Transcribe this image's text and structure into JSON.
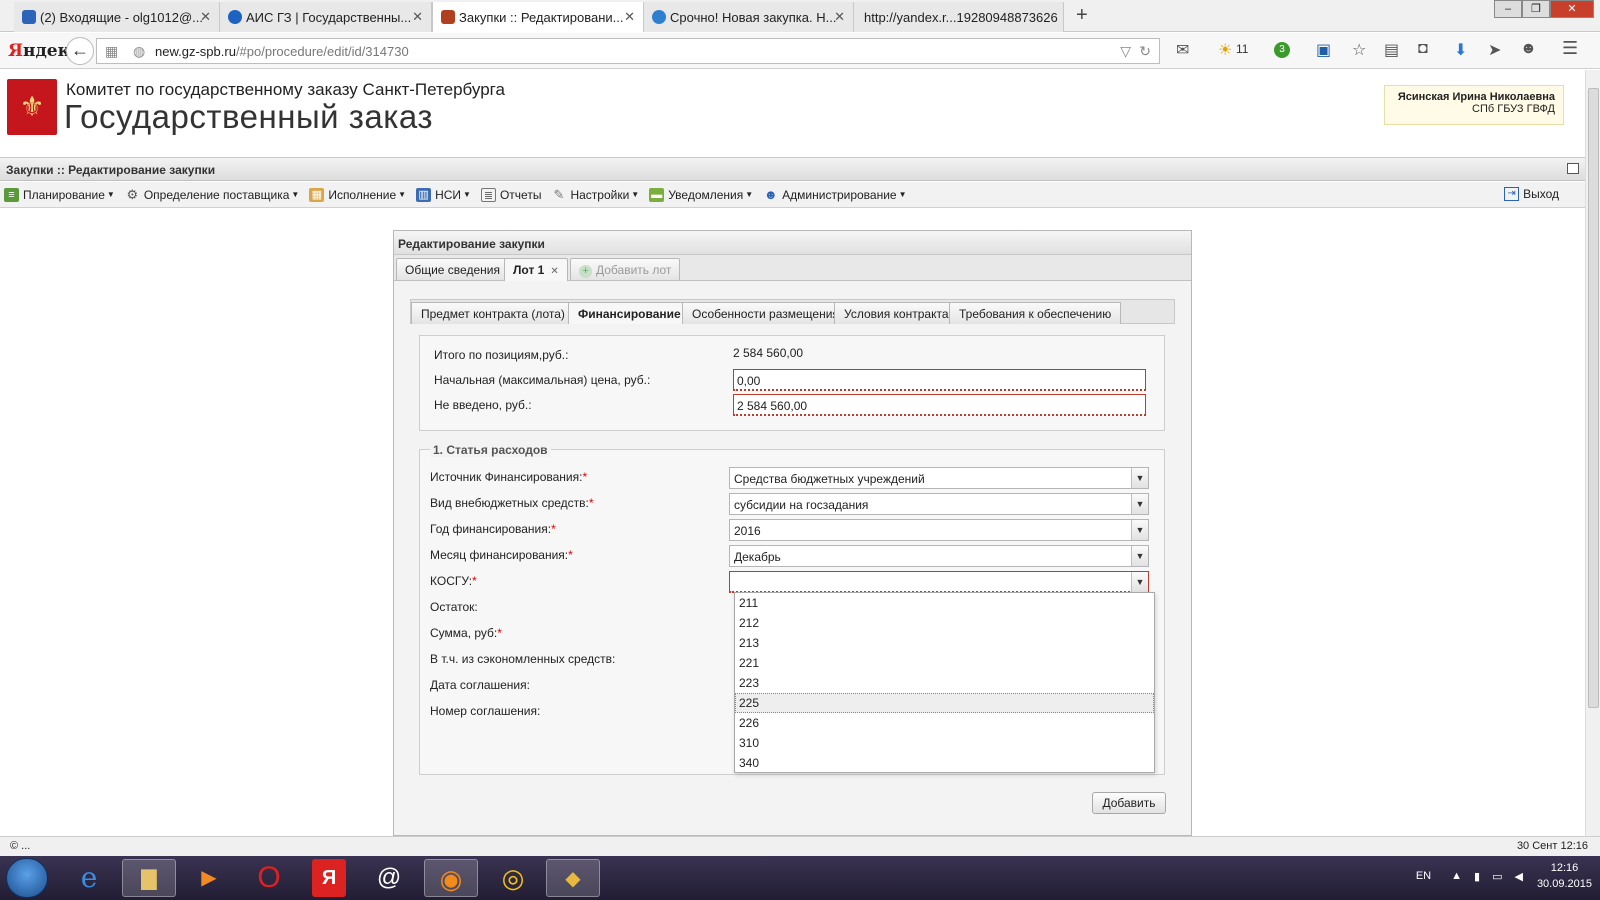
{
  "browser": {
    "tabs": [
      {
        "label": "(2) Входящие - olg1012@...",
        "color": "#2d63b8"
      },
      {
        "label": "АИС ГЗ | Государственны...",
        "color": "#1e62c2"
      },
      {
        "label": "Закупки :: Редактировани...",
        "color": "#b04020"
      },
      {
        "label": "Срочно! Новая закупка. Н...",
        "color": "#2f7fd0"
      },
      {
        "label": "http://yandex.r...19280948873626",
        "color": "#cccccc"
      }
    ],
    "new_tab": "+",
    "logo_letter": "Я",
    "logo_rest": "ндекс",
    "url_domain": "new.gz-spb.ru",
    "url_path": "/#po/procedure/edit/id/314730",
    "weather": "11",
    "badge_count": "3"
  },
  "header": {
    "org_name": "Комитет по государственному заказу Санкт-Петербурга",
    "site_title": "Государственный заказ",
    "user_name": "Ясинская Ирина Николаевна",
    "user_org": "СПб ГБУЗ ГВФД"
  },
  "app_title": "Закупки :: Редактирование закупки",
  "menu": {
    "items": [
      {
        "label": "Планирование",
        "icon": "planning-icon"
      },
      {
        "label": "Определение поставщика",
        "icon": "gears-icon"
      },
      {
        "label": "Исполнение",
        "icon": "execution-icon"
      },
      {
        "label": "НСИ",
        "icon": "book-icon"
      },
      {
        "label": "Отчеты",
        "icon": "report-icon"
      },
      {
        "label": "Настройки",
        "icon": "wrench-icon"
      },
      {
        "label": "Уведомления",
        "icon": "notification-icon"
      },
      {
        "label": "Администрирование",
        "icon": "user-icon"
      }
    ],
    "logout": "Выход"
  },
  "panel": {
    "title": "Редактирование закупки",
    "lot_tabs": [
      "Общие сведения",
      "Лот 1",
      "Добавить лот"
    ],
    "sub_tabs": [
      "Предмет контракта (лота)",
      "Финансирование",
      "Особенности размещения",
      "Условия контракта",
      "Требования к обеспечению"
    ],
    "totals": {
      "items_total_label": "Итого по позициям,руб.:",
      "items_total_value": "2 584 560,00",
      "initial_price_label": "Начальная (максимальная) цена, руб.:",
      "initial_price_value": "0,00",
      "not_entered_label": "Не введено, руб.:",
      "not_entered_value": "2 584 560,00"
    },
    "expense": {
      "legend": "1. Статья расходов",
      "source_label": "Источник Финансирования:",
      "source_value": "Средства бюджетных учреждений",
      "extra_label": "Вид внебюджетных средств:",
      "extra_value": "субсидии на госзадания",
      "year_label": "Год финансирования:",
      "year_value": "2016",
      "month_label": "Месяц финансирования:",
      "month_value": "Декабрь",
      "kosgu_label": "КОСГУ:",
      "kosgu_value": "",
      "remainder_label": "Остаток:",
      "sum_label": "Сумма, руб:",
      "saved_label": "В т.ч. из сэкономленных средств:",
      "date_label": "Дата соглашения:",
      "number_label": "Номер соглашения:",
      "required_mark": "*"
    },
    "kosgu_options": [
      "211",
      "212",
      "213",
      "221",
      "223",
      "225",
      "226",
      "310",
      "340"
    ],
    "kosgu_highlighted": "225",
    "add_button": "Добавить"
  },
  "statusbar": {
    "left": "© ...",
    "date": "30 Сент 12:16"
  },
  "taskbar": {
    "lang": "EN",
    "time": "12:16",
    "date": "30.09.2015"
  }
}
